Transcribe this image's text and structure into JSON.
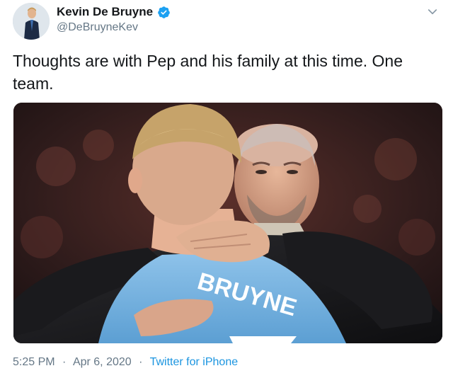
{
  "author": {
    "display_name": "Kevin De Bruyne",
    "handle": "@DeBruyneKev",
    "verified": true
  },
  "tweet": {
    "text": "Thoughts are with Pep and his family at this time. One team."
  },
  "media": {
    "jersey_text": "BRUYNE"
  },
  "meta": {
    "time": "5:25 PM",
    "date": "Apr 6, 2020",
    "separator": "·",
    "source": "Twitter for iPhone"
  },
  "colors": {
    "text": "#14171a",
    "secondary": "#657786",
    "link": "#1b95e0",
    "verified": "#1da1f2"
  },
  "icons": {
    "verified": "verified-badge-icon",
    "menu": "chevron-down-icon"
  }
}
